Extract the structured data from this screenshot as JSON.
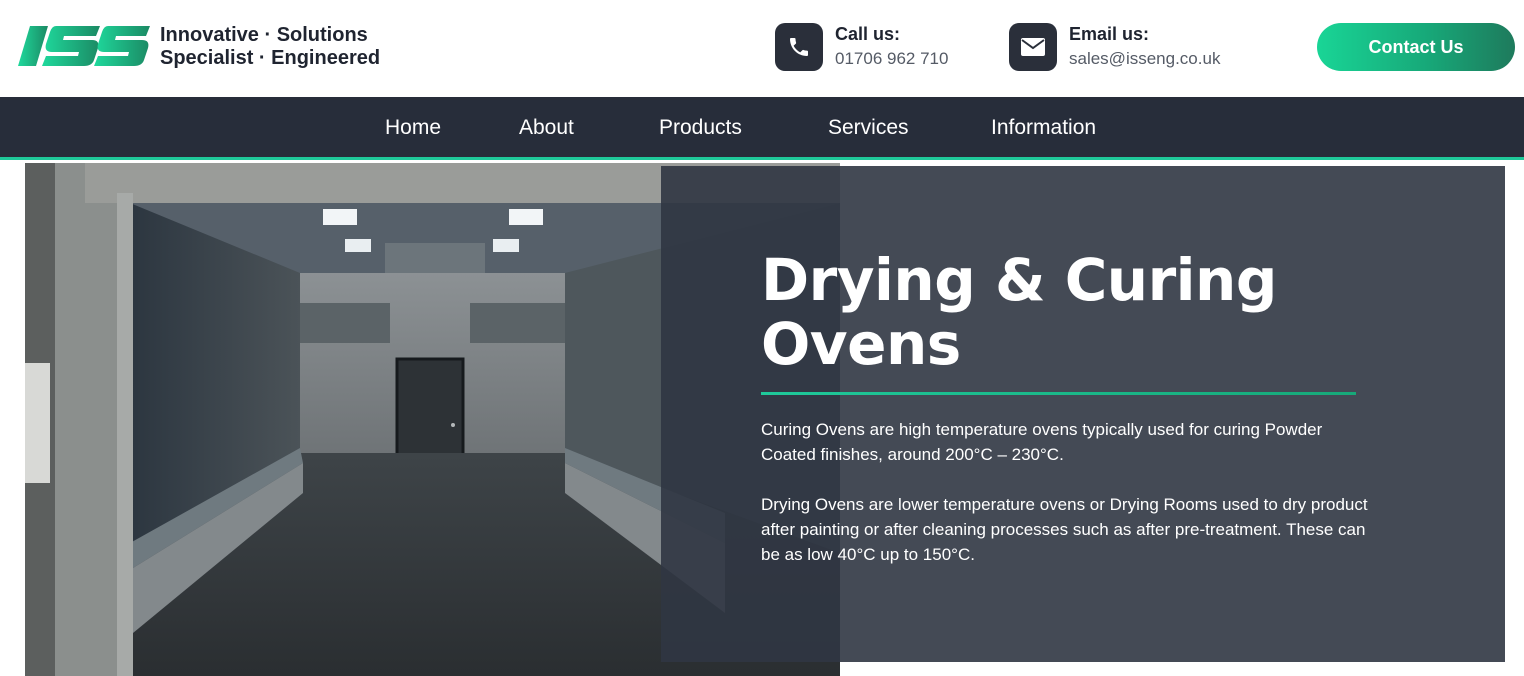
{
  "header": {
    "logo": {
      "mark": "ISS",
      "line1": "Innovative · Solutions",
      "line2": "Specialist · Engineered"
    },
    "phone": {
      "icon": "phone-icon",
      "title": "Call us:",
      "value": "01706 962 710"
    },
    "email": {
      "icon": "envelope-icon",
      "title": "Email us:",
      "value": "sales@isseng.co.uk"
    },
    "cta_label": "Contact Us"
  },
  "nav": {
    "items": [
      {
        "label": "Home"
      },
      {
        "label": "About"
      },
      {
        "label": "Products"
      },
      {
        "label": "Services"
      },
      {
        "label": "Information"
      }
    ]
  },
  "hero": {
    "title_line1": "Drying & Curing",
    "title_line2": "Ovens",
    "paragraph1": "Curing Ovens are high temperature ovens typically used for curing Powder Coated finishes, around 200°C – 230°C.",
    "paragraph2": "Drying Ovens are lower temperature ovens or Drying Rooms used to dry product after painting or after cleaning processes such as after pre-treatment.  These can be as low 40°C up to 150°C."
  },
  "colors": {
    "brand_green": "#1fc99a",
    "nav_bg": "#272d3a",
    "panel_bg": "#303643"
  }
}
